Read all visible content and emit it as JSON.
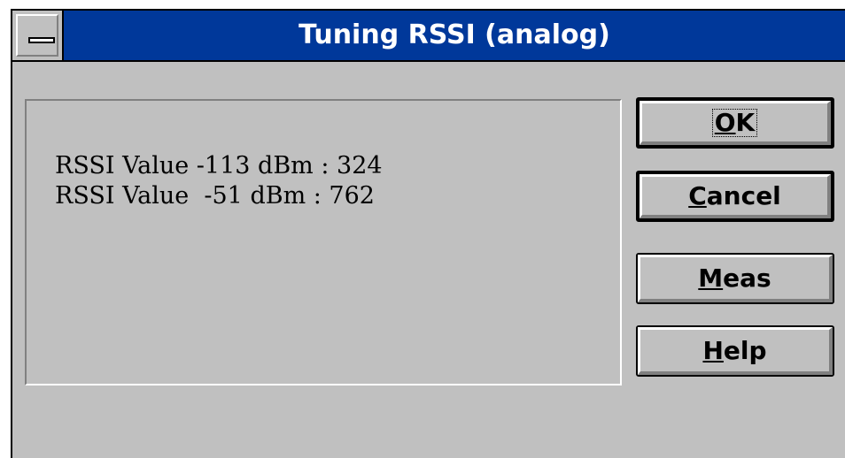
{
  "window": {
    "title": "Tuning RSSI (analog)"
  },
  "values": [
    "RSSI Value -113 dBm : 324",
    "RSSI Value  -51 dBm : 762"
  ],
  "buttons": {
    "ok": {
      "mnemonic": "O",
      "rest": "K"
    },
    "cancel": {
      "mnemonic": "C",
      "rest": "ancel"
    },
    "meas": {
      "mnemonic": "M",
      "rest": "eas"
    },
    "help": {
      "mnemonic": "H",
      "rest": "elp"
    }
  },
  "icons": {
    "system_menu": "system-menu-icon"
  },
  "colors": {
    "title_bar": "#00389a",
    "face": "#c0c0c0"
  }
}
